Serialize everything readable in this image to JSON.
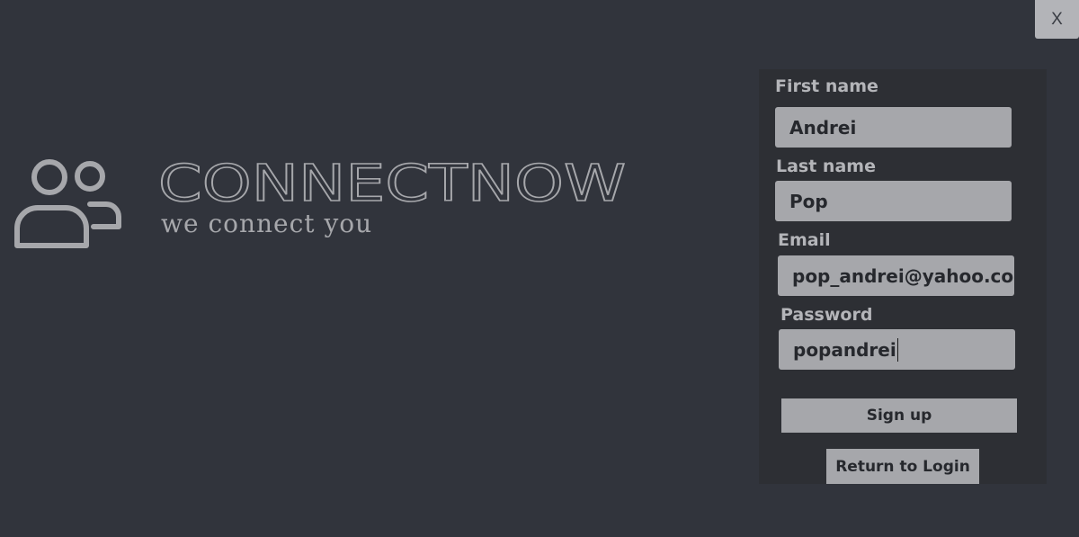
{
  "window": {
    "close_label": "X"
  },
  "brand": {
    "name": "CONNECTNOW",
    "tagline": "we connect you",
    "logo_icon": "users-icon"
  },
  "form": {
    "first_name": {
      "label": "First name",
      "value": "Andrei"
    },
    "last_name": {
      "label": "Last name",
      "value": "Pop"
    },
    "email": {
      "label": "Email",
      "value": "pop_andrei@yahoo.com"
    },
    "password": {
      "label": "Password",
      "value": "popandrei"
    },
    "signup_label": "Sign up",
    "return_label": "Return to Login"
  },
  "colors": {
    "background": "#31343c",
    "panel": "#2d2f34",
    "input_fill": "#a6a7ab",
    "label_text": "#b4b5b9",
    "logo_stroke": "#a6a7ab"
  }
}
